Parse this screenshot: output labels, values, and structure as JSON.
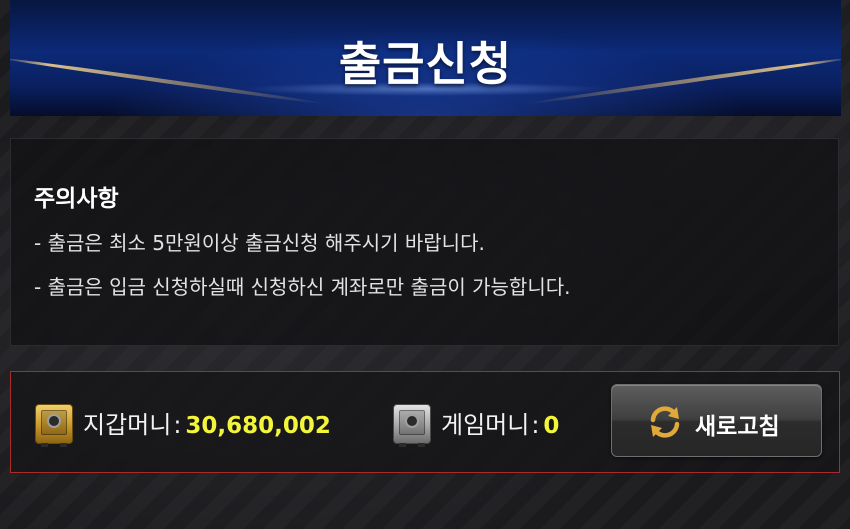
{
  "header": {
    "title": "출금신청"
  },
  "notice": {
    "title": "주의사항",
    "lines": [
      "- 출금은 최소 5만원이상 출금신청 해주시기 바랍니다.",
      "- 출금은 입금 신청하실때 신청하신 계좌로만 출금이 가능합니다."
    ]
  },
  "balance": {
    "wallet": {
      "label": "지갑머니",
      "colon": ":",
      "value": "30,680,002",
      "icon": "gold-safe-icon"
    },
    "game": {
      "label": "게임머니",
      "colon": ":",
      "value": "0",
      "icon": "silver-safe-icon"
    },
    "refresh_button": {
      "label": "새로고침",
      "icon": "refresh-icon"
    }
  },
  "colors": {
    "header_blue": "#0c2a78",
    "value_yellow": "#f3f53b",
    "panel_border_red": "#a82a2a",
    "refresh_icon_gold": "#e0a93a"
  }
}
